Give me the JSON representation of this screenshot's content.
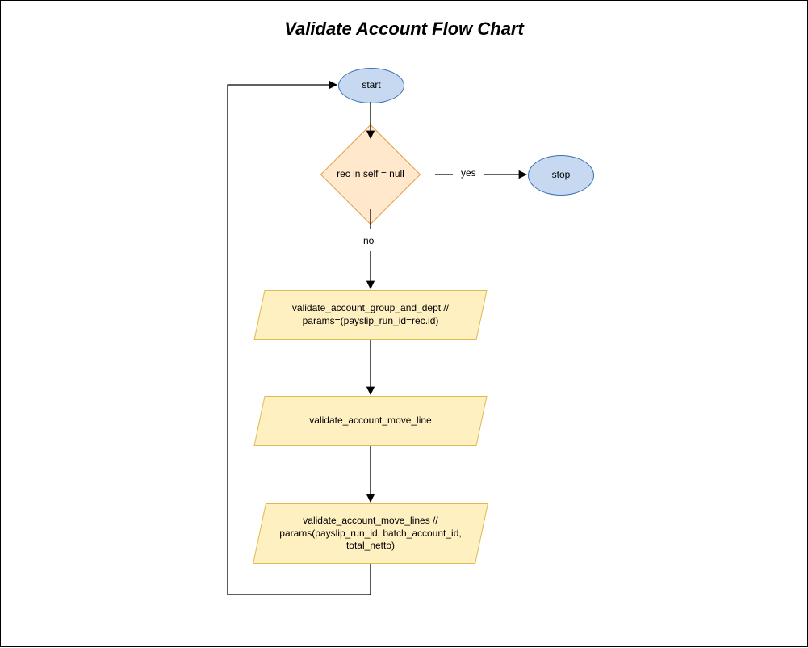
{
  "title": "Validate Account Flow Chart",
  "nodes": {
    "start": "start",
    "decision": "rec in self = null",
    "stop": "stop",
    "proc1": "validate_account_group_and_dept // params=(payslip_run_id=rec.id)",
    "proc2": "validate_account_move_line",
    "proc3": "validate_account_move_lines // params(payslip_run_id, batch_account_id, total_netto)"
  },
  "edges": {
    "yes": "yes",
    "no": "no"
  }
}
